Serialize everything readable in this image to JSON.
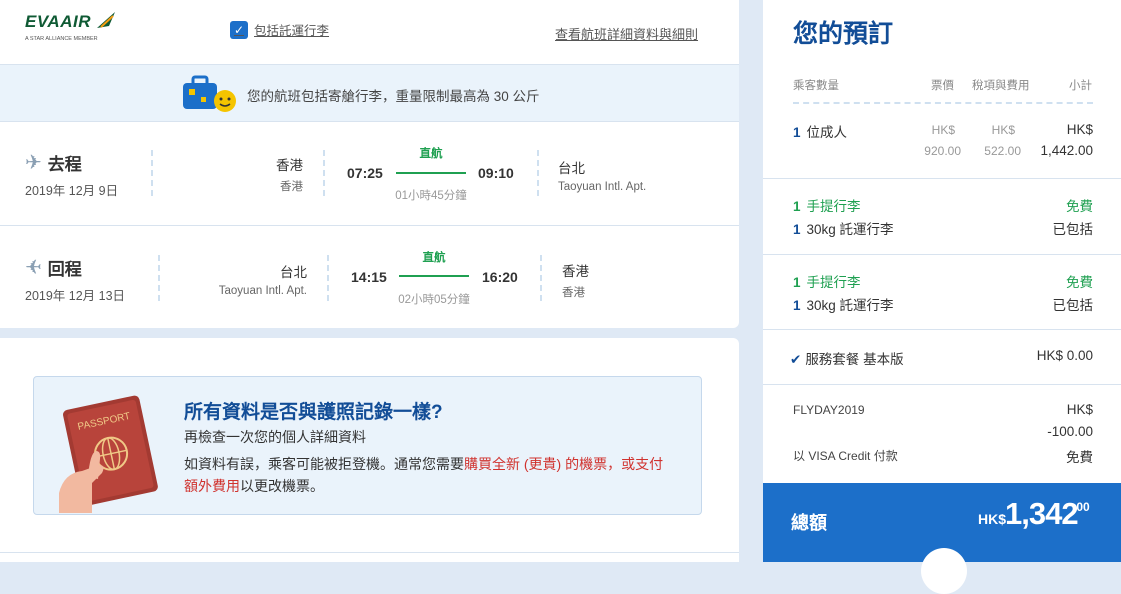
{
  "header": {
    "logo_text": "EVAAIR",
    "logo_sub": "A STAR ALLIANCE MEMBER",
    "baggage_link": "包括託運行李",
    "details_link": "查看航班詳細資料與細則"
  },
  "banner": {
    "text": "您的航班包括寄艙行李，重量限制最高為 30 公斤"
  },
  "outbound": {
    "title": "去程",
    "date": "2019年 12月 9日",
    "from_city": "香港",
    "from_airport": "香港",
    "depart_time": "07:25",
    "direct_label": "直航",
    "arrive_time": "09:10",
    "duration": "01小時45分鐘",
    "to_city": "台北",
    "to_airport": "Taoyuan Intl. Apt."
  },
  "return": {
    "title": "回程",
    "date": "2019年 12月 13日",
    "from_city": "台北",
    "from_airport": "Taoyuan Intl. Apt.",
    "depart_time": "14:15",
    "direct_label": "直航",
    "arrive_time": "16:20",
    "duration": "02小時05分鐘",
    "to_city": "香港",
    "to_airport": "香港"
  },
  "passport": {
    "title": "所有資料是否與護照記錄一樣?",
    "subtitle": "再檢查一次您的個人詳細資料",
    "body_1": "如資料有誤，乘客可能被拒登機。通常您需要",
    "body_red_1": "購買全新 (更貴) 的機票",
    "body_2": "，或",
    "body_red_2": "支付額外費用",
    "body_3": "以更改機票。",
    "passport_label": "PASSPORT"
  },
  "booking": {
    "title": "您的預訂",
    "headers": {
      "passengers": "乘客數量",
      "fare": "票價",
      "tax": "稅項與費用",
      "subtotal": "小計"
    },
    "passenger_count": "1",
    "passenger_label": "位成人",
    "fare_currency": "HK$",
    "fare_amount": "920.00",
    "tax_currency": "HK$",
    "tax_amount": "522.00",
    "subtotal_currency": "HK$",
    "subtotal_amount": "1,442.00",
    "baggage_groups": [
      {
        "carry_count": "1",
        "carry_label": "手提行李",
        "carry_value": "免費",
        "checked_count": "1",
        "checked_label": "30kg 託運行李",
        "checked_value": "已包括"
      },
      {
        "carry_count": "1",
        "carry_label": "手提行李",
        "carry_value": "免費",
        "checked_count": "1",
        "checked_label": "30kg 託運行李",
        "checked_value": "已包括"
      }
    ],
    "service_label": "服務套餐 基本版",
    "service_value": "HK$ 0.00",
    "promo_code": "FLYDAY2019",
    "promo_currency": "HK$",
    "promo_amount": "-100.00",
    "payment_label": "以 VISA Credit 付款",
    "payment_value": "免費",
    "total_label": "總額",
    "total_currency": "HK$",
    "total_amount": "1,342",
    "total_decimals": ".00"
  },
  "colors": {
    "brand_blue": "#124d97",
    "accent_blue": "#1c6fc9",
    "green": "#1fa051",
    "red": "#d0322e"
  }
}
